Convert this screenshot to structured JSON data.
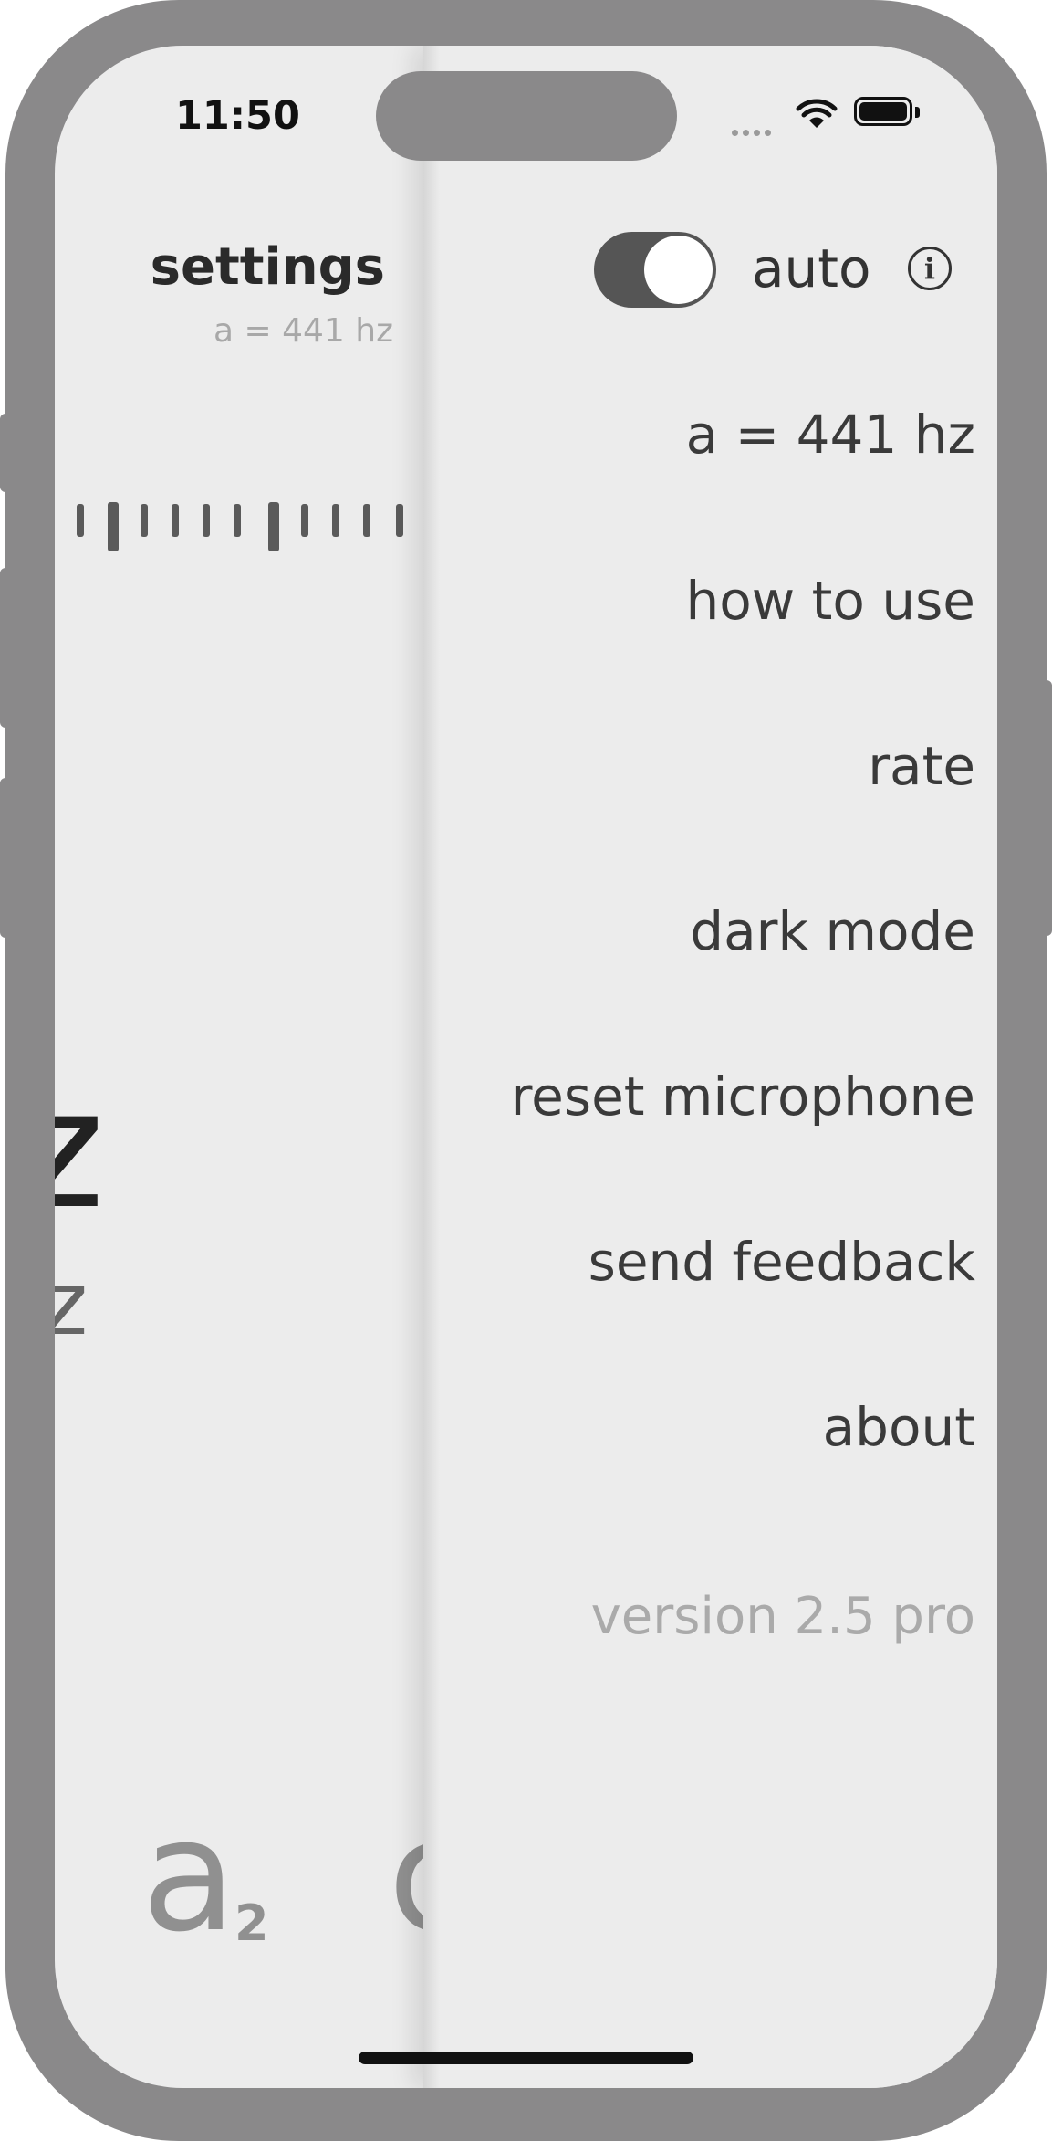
{
  "status_bar": {
    "time": "11:50"
  },
  "underlay": {
    "settings_title": "settings",
    "settings_subtitle": "a = 441 hz",
    "big_text": "z",
    "small_text": "hz",
    "note_letter": "a",
    "note_octave": "2",
    "next_note": "c"
  },
  "menu": {
    "auto_label": "auto",
    "auto_enabled": true,
    "items": [
      {
        "label": "a =  441 hz"
      },
      {
        "label": "how to use"
      },
      {
        "label": "rate"
      },
      {
        "label": "dark mode"
      },
      {
        "label": "reset microphone"
      },
      {
        "label": "send feedback"
      },
      {
        "label": "about"
      }
    ],
    "version": "version 2.5 pro"
  },
  "colors": {
    "device_frame": "#8a898a",
    "screen_bg": "#ececec",
    "toggle_on": "#555555",
    "muted_text": "#aaaaaa"
  }
}
